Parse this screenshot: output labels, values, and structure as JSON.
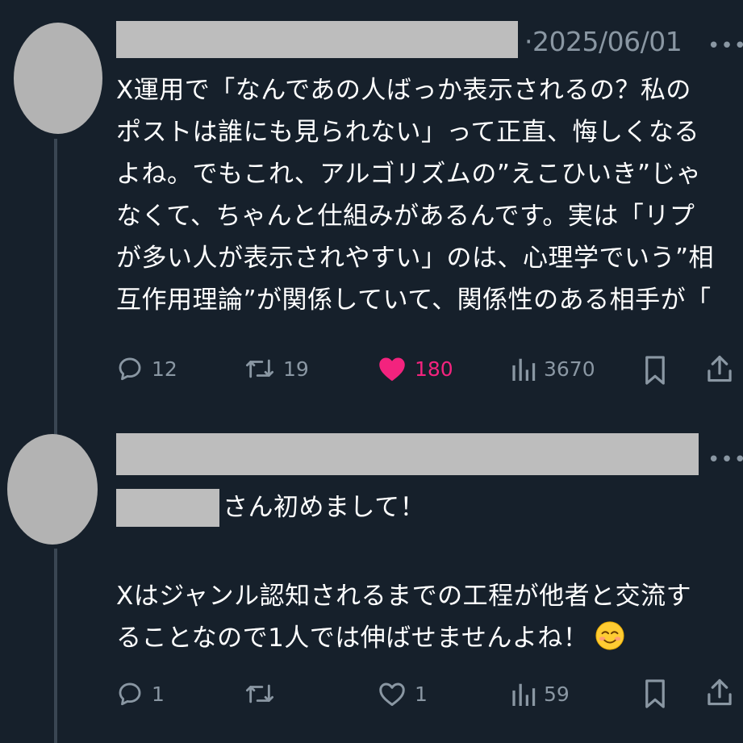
{
  "posts": [
    {
      "separator": "·",
      "timestamp": "2025/06/01",
      "more": "•••",
      "lines": [
        "X運用で「なんであの人ばっか表示されるの？私の",
        "ポストは誰にも見られない」って正直、悔しくなる",
        "よね。でもこれ、アルゴリズムの”えこひいき”じゃ",
        "なくて、ちゃんと仕組みがあるんです。実は「リプ",
        "が多い人が表示されやすい」のは、心理学でいう”相",
        "互作用理論”が関係していて、関係性のある相手が「"
      ],
      "actions": {
        "replies": "12",
        "reposts": "19",
        "likes": "180",
        "views": "3670"
      },
      "liked": true
    },
    {
      "more": "•••",
      "mention_suffix": "さん初めまして！",
      "lines": [
        "Xはジャンル認知されるまでの工程が他者と交流す",
        "ることなので1人では伸ばせませんよね！"
      ],
      "emoji": "smiling-face-icon",
      "actions": {
        "replies": "1",
        "reposts": "",
        "likes": "1",
        "views": "59"
      },
      "liked": false
    }
  ],
  "colors": {
    "background": "#16202b",
    "text": "#ffffff",
    "muted": "#8a97a3",
    "like": "#f3237e",
    "redaction": "#bdbdbd"
  }
}
